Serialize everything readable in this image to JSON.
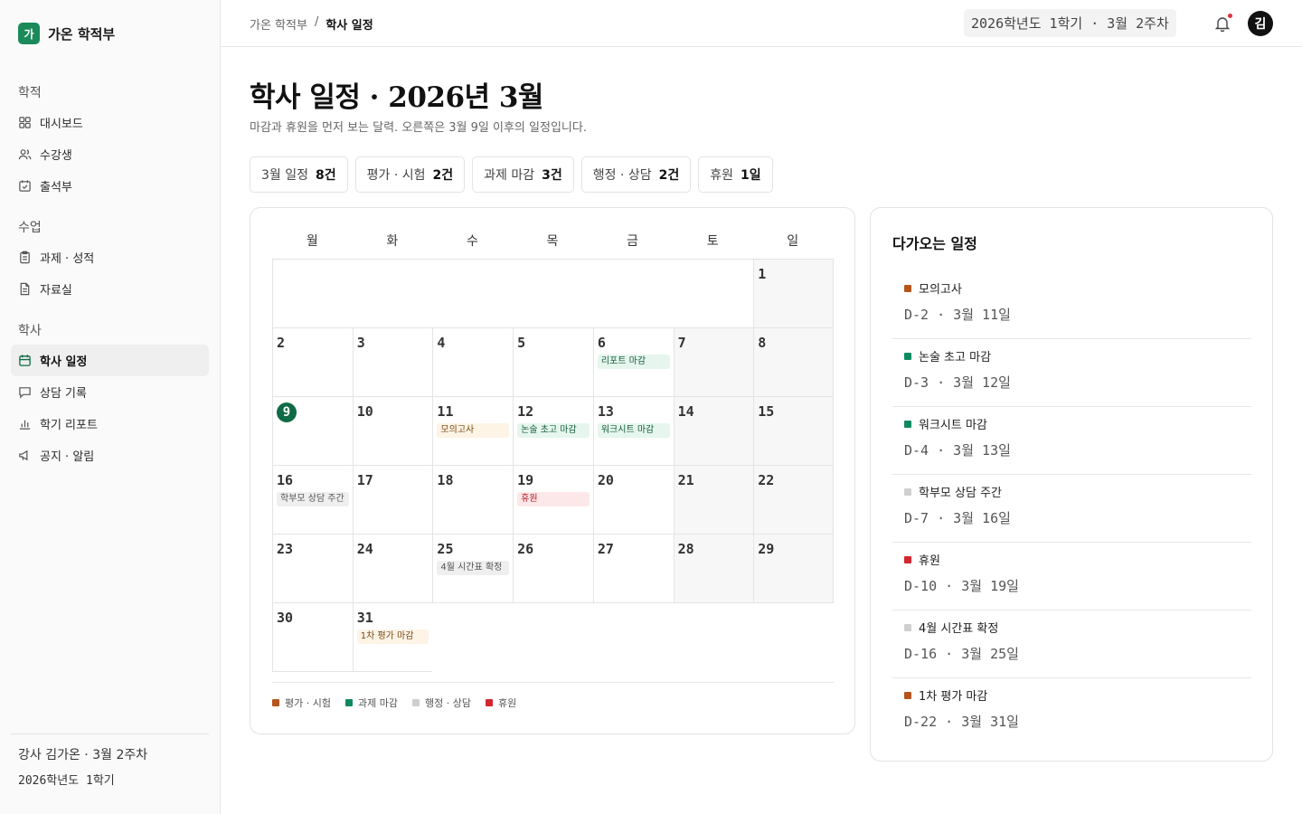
{
  "sidebar": {
    "logo": "가",
    "brand": "가온 학적부",
    "sections": [
      {
        "heading": "학적",
        "items": [
          {
            "label": "대시보드"
          },
          {
            "label": "수강생"
          },
          {
            "label": "출석부"
          }
        ]
      },
      {
        "heading": "수업",
        "items": [
          {
            "label": "과제 · 성적"
          },
          {
            "label": "자료실"
          }
        ]
      },
      {
        "heading": "학사",
        "items": [
          {
            "label": "학사 일정"
          },
          {
            "label": "상담 기록"
          },
          {
            "label": "학기 리포트"
          },
          {
            "label": "공지 · 알림"
          }
        ]
      }
    ],
    "footer": {
      "line1": "강사 김가온 · 3월 2주차",
      "line2": "2026학년도 1학기"
    }
  },
  "topbar": {
    "crumb_parent": "가온 학적부",
    "crumb_sep": "/",
    "crumb_current": "학사 일정",
    "term": "2026학년도 1학기 · 3월 2주차",
    "avatar": "김"
  },
  "page": {
    "title": "학사 일정 · 2026년 3월",
    "subtitle": "마감과 휴원을 먼저 보는 달력. 오른쪽은 3월 9일 이후의 일정입니다."
  },
  "stats": [
    {
      "label": "3월 일정",
      "value": "8건"
    },
    {
      "label": "평가 · 시험",
      "value": "2건"
    },
    {
      "label": "과제 마감",
      "value": "3건"
    },
    {
      "label": "행정 · 상담",
      "value": "2건"
    },
    {
      "label": "휴원",
      "value": "1일"
    }
  ],
  "calendar": {
    "weekdays": [
      "월",
      "화",
      "수",
      "목",
      "금",
      "토",
      "일"
    ],
    "weeks": [
      [
        null,
        null,
        null,
        null,
        null,
        null,
        {
          "day": "1"
        }
      ],
      [
        {
          "day": "2"
        },
        {
          "day": "3"
        },
        {
          "day": "4"
        },
        {
          "day": "5"
        },
        {
          "day": "6",
          "event": {
            "label": "리포트 마감",
            "type": "task"
          }
        },
        {
          "day": "7"
        },
        {
          "day": "8"
        }
      ],
      [
        {
          "day": "9",
          "today": true
        },
        {
          "day": "10"
        },
        {
          "day": "11",
          "event": {
            "label": "모의고사",
            "type": "exam"
          }
        },
        {
          "day": "12",
          "event": {
            "label": "논술 초고 마감",
            "type": "task"
          }
        },
        {
          "day": "13",
          "event": {
            "label": "워크시트 마감",
            "type": "task"
          }
        },
        {
          "day": "14"
        },
        {
          "day": "15"
        }
      ],
      [
        {
          "day": "16",
          "event": {
            "label": "학부모 상담 주간",
            "type": "admin"
          }
        },
        {
          "day": "17"
        },
        {
          "day": "18"
        },
        {
          "day": "19",
          "event": {
            "label": "휴원",
            "type": "holiday"
          }
        },
        {
          "day": "20"
        },
        {
          "day": "21"
        },
        {
          "day": "22"
        }
      ],
      [
        {
          "day": "23"
        },
        {
          "day": "24"
        },
        {
          "day": "25",
          "event": {
            "label": "4월 시간표 확정",
            "type": "admin"
          }
        },
        {
          "day": "26"
        },
        {
          "day": "27"
        },
        {
          "day": "28"
        },
        {
          "day": "29"
        }
      ],
      [
        {
          "day": "30"
        },
        {
          "day": "31",
          "event": {
            "label": "1차 평가 마감",
            "type": "exam"
          }
        },
        null,
        null,
        null,
        null,
        null
      ]
    ],
    "legend": [
      {
        "label": "평가 · 시험",
        "color": "#b5561c"
      },
      {
        "label": "과제 마감",
        "color": "#0f8a5f"
      },
      {
        "label": "행정 · 상담",
        "color": "#cfcfcf"
      },
      {
        "label": "휴원",
        "color": "#d4262f"
      }
    ]
  },
  "upcoming": {
    "title": "다가오는 일정",
    "items": [
      {
        "name": "모의고사",
        "meta": "D-2 · 3월 11일",
        "color": "#b5561c"
      },
      {
        "name": "논술 초고 마감",
        "meta": "D-3 · 3월 12일",
        "color": "#0f8a5f"
      },
      {
        "name": "워크시트 마감",
        "meta": "D-4 · 3월 13일",
        "color": "#0f8a5f"
      },
      {
        "name": "학부모 상담 주간",
        "meta": "D-7 · 3월 16일",
        "color": "#cfcfcf"
      },
      {
        "name": "휴원",
        "meta": "D-10 · 3월 19일",
        "color": "#d4262f"
      },
      {
        "name": "4월 시간표 확정",
        "meta": "D-16 · 3월 25일",
        "color": "#cfcfcf"
      },
      {
        "name": "1차 평가 마감",
        "meta": "D-22 · 3월 31일",
        "color": "#b5561c"
      }
    ]
  }
}
